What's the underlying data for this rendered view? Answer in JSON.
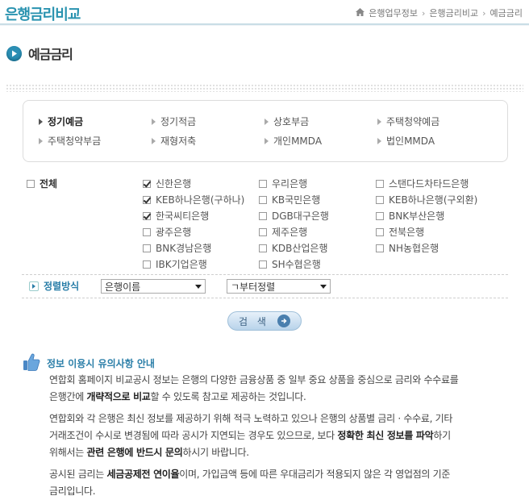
{
  "header": {
    "site_title": "은행금리비교",
    "breadcrumb": [
      "은행업무정보",
      "은행금리비교",
      "예금금리"
    ]
  },
  "page_title": "예금금리",
  "products": [
    {
      "label": "정기예금",
      "selected": true
    },
    {
      "label": "정기적금",
      "selected": false
    },
    {
      "label": "상호부금",
      "selected": false
    },
    {
      "label": "주택청약예금",
      "selected": false
    },
    {
      "label": "주택청약부금",
      "selected": false
    },
    {
      "label": "재형저축",
      "selected": false
    },
    {
      "label": "개인MMDA",
      "selected": false
    },
    {
      "label": "법인MMDA",
      "selected": false
    }
  ],
  "banks": {
    "all_label": "전체",
    "all_checked": false,
    "items": [
      {
        "label": "신한은행",
        "checked": true
      },
      {
        "label": "우리은행",
        "checked": false
      },
      {
        "label": "스탠다드차타드은행",
        "checked": false
      },
      {
        "label": "KEB하나은행(구하나)",
        "checked": true
      },
      {
        "label": "KB국민은행",
        "checked": false
      },
      {
        "label": "KEB하나은행(구외환)",
        "checked": false
      },
      {
        "label": "한국씨티은행",
        "checked": true
      },
      {
        "label": "DGB대구은행",
        "checked": false
      },
      {
        "label": "BNK부산은행",
        "checked": false
      },
      {
        "label": "광주은행",
        "checked": false
      },
      {
        "label": "제주은행",
        "checked": false
      },
      {
        "label": "전북은행",
        "checked": false
      },
      {
        "label": "BNK경남은행",
        "checked": false
      },
      {
        "label": "KDB산업은행",
        "checked": false
      },
      {
        "label": "NH농협은행",
        "checked": false
      },
      {
        "label": "IBK기업은행",
        "checked": false
      },
      {
        "label": "SH수협은행",
        "checked": false
      }
    ]
  },
  "sort": {
    "label": "정렬방식",
    "field_value": "은행이름",
    "order_value": "ㄱ부터정렬"
  },
  "search_button": "검 색",
  "notice": {
    "title": "정보 이용시 유의사항 안내",
    "p1_a": "연합회 홈페이지 비교공시 정보는 은행의 다양한 금융상품 중 일부 중요 상품을 중심으로 금리와 수수료를",
    "p1_b": "은행간에 ",
    "p1_bold": "개략적으로 비교",
    "p1_c": "할 수 있도록 참고로 제공하는 것입니다.",
    "p2_a": "연합회와 각 은행은 최신 정보를 제공하기 위해 적극 노력하고 있으나 은행의 상품별 금리 · 수수료, 기타",
    "p2_b": "거래조건이 수시로 변경됨에 따라 공시가 지연되는 경우도 있으므로, 보다 ",
    "p2_bold1": "정확한 최신 정보를 파악",
    "p2_c": "하기",
    "p2_d": "위해서는 ",
    "p2_bold2": "관련 은행에 반드시 문의",
    "p2_e": "하시기 바랍니다.",
    "p3_a": "공시된 금리는 ",
    "p3_bold": "세금공제전 연이율",
    "p3_b": "이며, 가입금액 등에 따른 우대금리가 적용되지 않은 각 영업점의 기준",
    "p3_c": "금리입니다."
  },
  "colors": {
    "accent": "#2a93b0",
    "link": "#2a7ea8"
  }
}
